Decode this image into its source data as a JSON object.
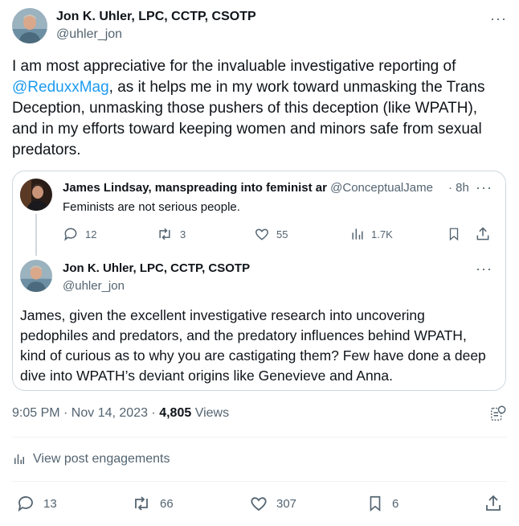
{
  "author": {
    "name": "Jon K. Uhler, LPC, CCTP, CSOTP",
    "handle": "@uhler_jon"
  },
  "tweet": {
    "text_before": "I am most appreciative for the invaluable investigative reporting of ",
    "mention": "@ReduxxMag",
    "text_after": ", as it helps me in my work toward unmasking the Trans Deception, unmasking those pushers of this deception (like WPATH), and in my efforts toward keeping women and minors safe from sexual predators."
  },
  "quoted_parent": {
    "name": "James Lindsay, manspreading into feminist ar",
    "handle": "@ConceptualJame",
    "time": "· 8h",
    "text": "Feminists are not serious people.",
    "replies": "12",
    "reposts": "3",
    "likes": "55",
    "views": "1.7K"
  },
  "quoted_reply": {
    "name": "Jon K. Uhler, LPC, CCTP, CSOTP",
    "handle": "@uhler_jon",
    "text": "James, given the excellent investigative research into uncovering pedophiles and predators, and the predatory influences behind WPATH, kind of curious as to why you are castigating them? Few have done a deep dive into WPATH’s deviant origins like Genevieve and Anna."
  },
  "meta": {
    "time": "9:05 PM · Nov 14, 2023 · ",
    "views_count": "4,805",
    "views_label": " Views"
  },
  "engagements_label": "View post engagements",
  "actions": {
    "replies": "13",
    "reposts": "66",
    "likes": "307",
    "bookmarks": "6"
  },
  "colors": {
    "accent": "#1d9bf0",
    "text": "#0f1419",
    "muted": "#536471",
    "border": "#cfd9de"
  }
}
